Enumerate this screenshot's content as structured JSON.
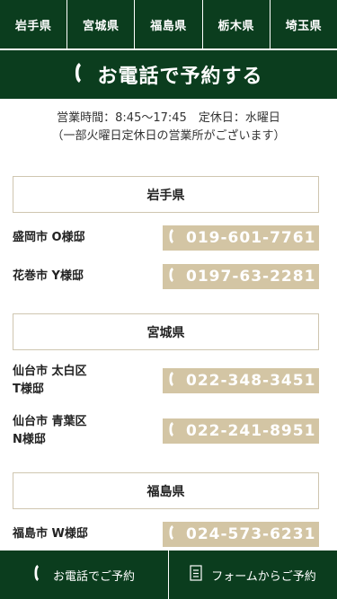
{
  "tabs": [
    "岩手県",
    "宮城県",
    "福島県",
    "栃木県",
    "埼玉県"
  ],
  "hero": {
    "title": "お電話で予約する"
  },
  "hours": {
    "line1": "営業時間：8:45〜17:45　定休日：水曜日",
    "line2": "（一部火曜日定休日の営業所がございます）"
  },
  "sections": [
    {
      "prefecture": "岩手県",
      "entries": [
        {
          "label": "盛岡市 O様邸",
          "phone": "019-601-7761"
        },
        {
          "label": "花巻市 Y様邸",
          "phone": "0197-63-2281"
        }
      ]
    },
    {
      "prefecture": "宮城県",
      "entries": [
        {
          "label_line1": "仙台市 太白区",
          "label_line2": "T様邸",
          "phone": "022-348-3451"
        },
        {
          "label_line1": "仙台市 青葉区",
          "label_line2": "N様邸",
          "phone": "022-241-8951"
        }
      ]
    },
    {
      "prefecture": "福島県",
      "entries": [
        {
          "label": "福島市 W様邸",
          "phone": "024-573-6231"
        }
      ]
    }
  ],
  "bottom_bar": {
    "call_label": "お電話でご予約",
    "form_label": "フォームからご予約"
  },
  "colors": {
    "dark_green": "#0b3d1e",
    "phone_bg": "#d3c5a4",
    "box_border": "#cfc6b0"
  },
  "icons": {
    "phone": "phone-handset-icon",
    "form": "form-document-icon"
  }
}
